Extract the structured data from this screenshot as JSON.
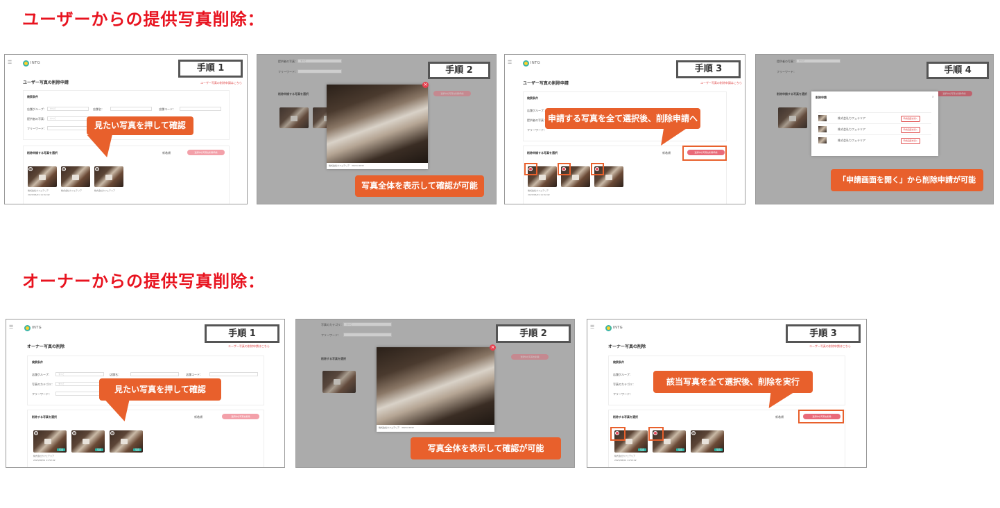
{
  "sections": [
    {
      "title": "ユーザーからの提供写真削除："
    },
    {
      "title": "オーナーからの提供写真削除："
    }
  ],
  "logo_text": "INTG",
  "user_flow": {
    "page_title": "ユーザー写真の削除申請",
    "page_link": "ユーザー写真の削除申請はこちら",
    "search_heading": "検索条件",
    "filter_labels": [
      "店舗グループ：",
      "提供者の写真：",
      "フリーワード：",
      "店舗名：",
      "店舗コード："
    ],
    "filter_value": "すべて",
    "list_heading": "削除申請する写真を選択",
    "sort_label": "新着順",
    "apply_button": "選択中の写真を削除申請",
    "steps": [
      {
        "badge": "手順 1",
        "callout": "見たい写真を押して確認"
      },
      {
        "badge": "手順 2",
        "callout": "写真全体を表示して確認が可能"
      },
      {
        "badge": "手順 3",
        "callout": "申請する写真を全て選択後、削除申請へ"
      },
      {
        "badge": "手順 4",
        "callout": "「申請画面を開く」から削除申請が可能"
      }
    ],
    "dialog_title": "削除申請",
    "dialog_row_button": "申請画面を開く",
    "dialog_row_text": "株式会社カフェテリア"
  },
  "owner_flow": {
    "page_title": "オーナー写真の削除",
    "page_link": "ユーザー写真の削除申請はこちら",
    "search_heading": "検索条件",
    "filter_labels": [
      "店舗グループ：",
      "写真のカテゴリ：",
      "フリーワード：",
      "店舗名：",
      "店舗コード："
    ],
    "filter_value": "すべて",
    "list_heading": "削除する写真を選択",
    "sort_label": "新着順",
    "apply_button": "選択中の写真を削除",
    "steps": [
      {
        "badge": "手順 1",
        "callout": "見たい写真を押して確認"
      },
      {
        "badge": "手順 2",
        "callout": "写真全体を表示して確認が可能"
      },
      {
        "badge": "手順 3",
        "callout": "該当写真を全て選択後、削除を実行"
      }
    ]
  },
  "photo_caption": "株式会社カフェテリア",
  "photo_date": "2023/06/01 11:52:42",
  "photo_tag": "写真",
  "modal_caption": "株式会社カフェテリア　3024×4032",
  "colors": {
    "accent": "#e8602c",
    "title_red": "#e8131f",
    "teal": "#2bb3a3"
  }
}
